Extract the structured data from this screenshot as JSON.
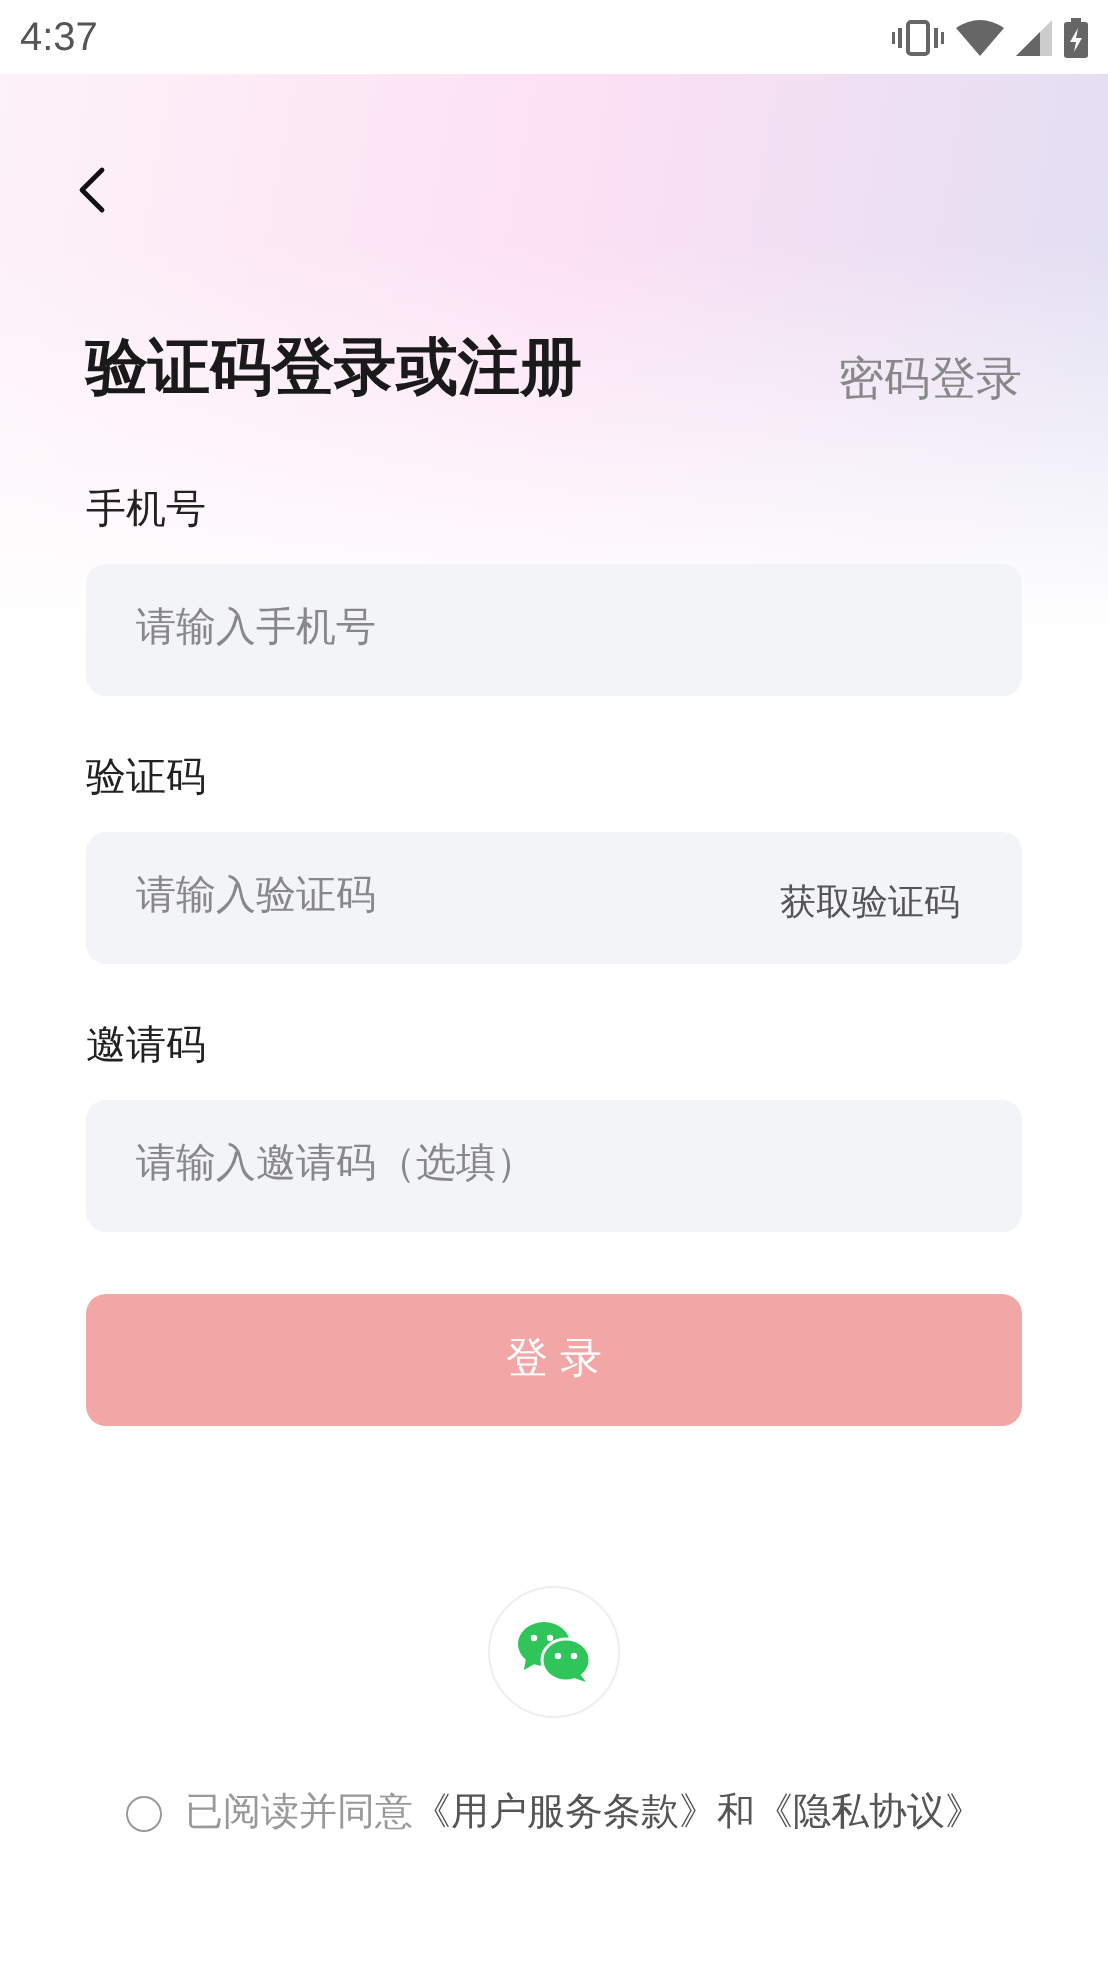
{
  "status_bar": {
    "time": "4:37"
  },
  "title": "验证码登录或注册",
  "switch_link": "密码登录",
  "fields": [
    {
      "label": "手机号",
      "placeholder": "请输入手机号"
    },
    {
      "label": "验证码",
      "placeholder": "请输入验证码",
      "action": "获取验证码"
    },
    {
      "label": "邀请码",
      "placeholder": "请输入邀请码（选填）"
    }
  ],
  "login_button": {
    "label": "登 录",
    "disabled": true
  },
  "agreement": {
    "checked": false,
    "text": "已阅读并同意",
    "link_1": "《用户服务条款》",
    "conjunction": "和",
    "link_2": "《隐私协议》"
  }
}
